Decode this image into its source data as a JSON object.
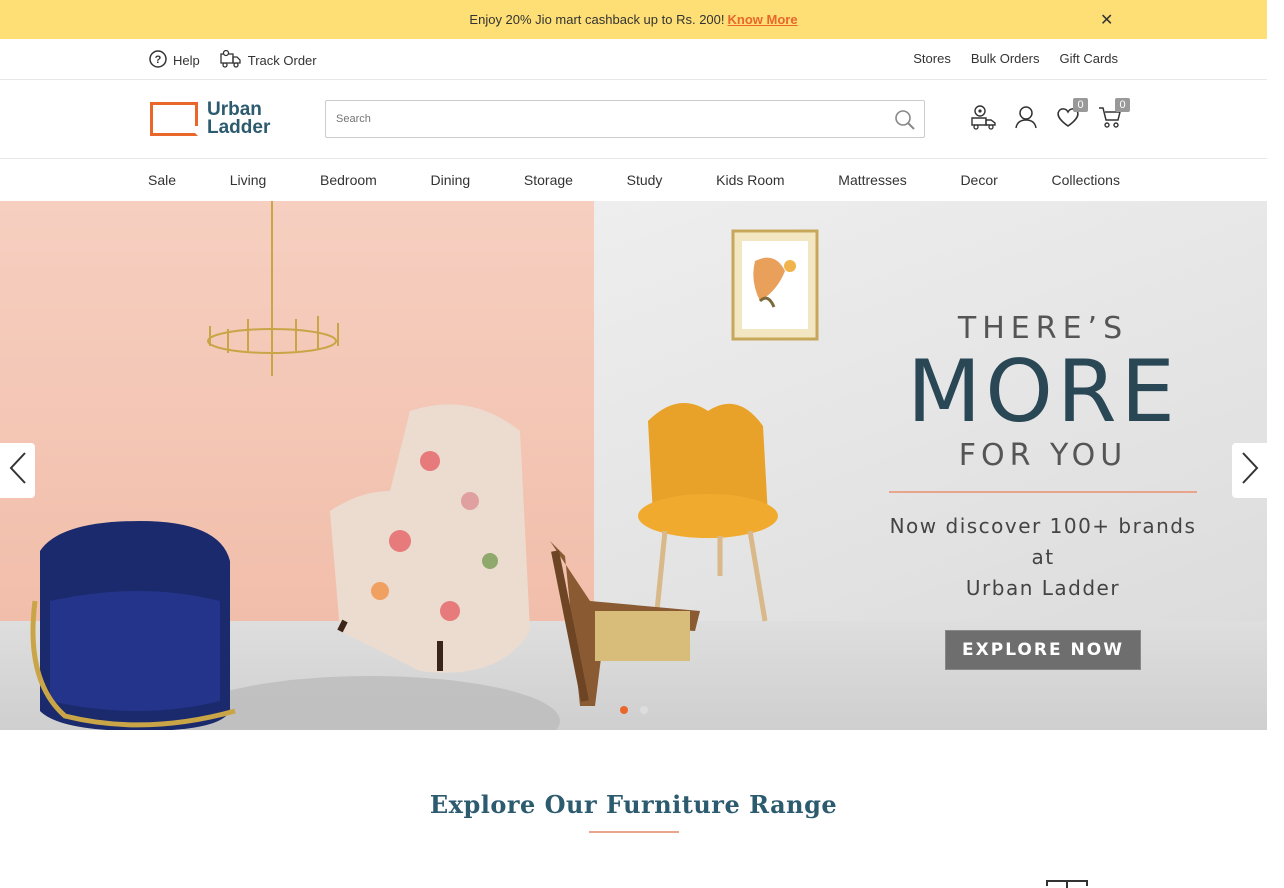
{
  "promo": {
    "text": "Enjoy 20% Jio mart cashback up to Rs. 200!",
    "link": "Know More",
    "close": "✕"
  },
  "utility": {
    "help": "Help",
    "track_order": "Track Order",
    "stores": "Stores",
    "bulk_orders": "Bulk Orders",
    "gift_cards": "Gift Cards"
  },
  "header": {
    "logo_line1": "Urban",
    "logo_line2": "Ladder",
    "search_placeholder": "Search",
    "wishlist_count": "0",
    "cart_count": "0"
  },
  "nav": {
    "items": [
      "Sale",
      "Living",
      "Bedroom",
      "Dining",
      "Storage",
      "Study",
      "Kids Room",
      "Mattresses",
      "Decor",
      "Collections"
    ]
  },
  "hero": {
    "line1": "THERE’S",
    "line2": "MORE",
    "line3": "FOR YOU",
    "discover1": "Now discover 100+ brands at",
    "discover2": "Urban Ladder",
    "cta": "EXPLORE NOW",
    "slides": 2,
    "active_slide": 1
  },
  "section": {
    "title": "Explore Our Furniture Range"
  },
  "colors": {
    "accent": "#e9672b",
    "brand_dark": "#2c5a6e",
    "promo_bg": "#fddf75"
  }
}
